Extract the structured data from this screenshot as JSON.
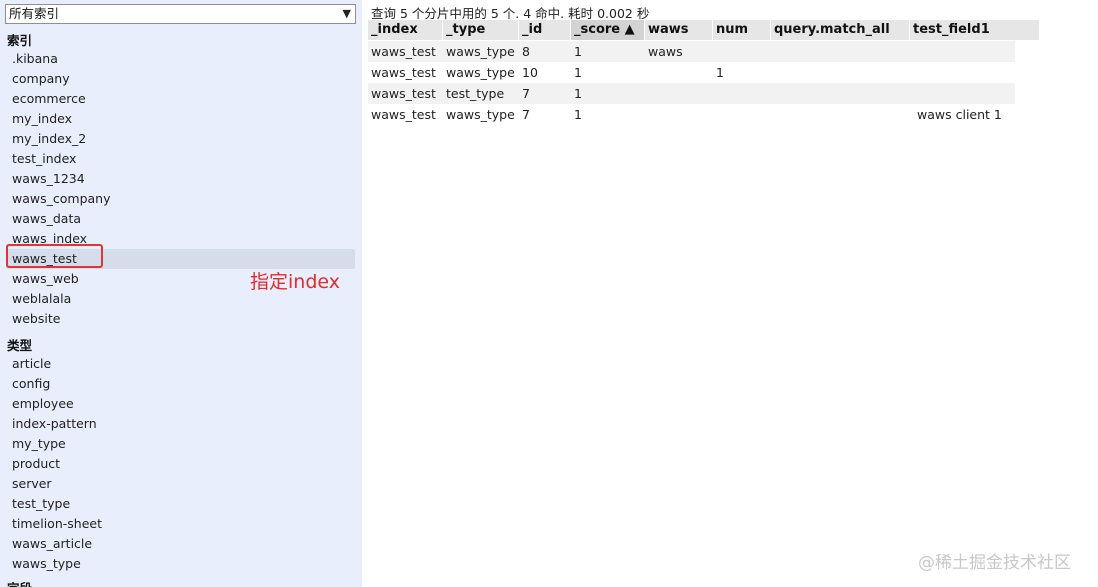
{
  "sidebar": {
    "index_select_value": "所有索引",
    "indices_title": "索引",
    "indices": [
      ".kibana",
      "company",
      "ecommerce",
      "my_index",
      "my_index_2",
      "test_index",
      "waws_1234",
      "waws_company",
      "waws_data",
      "waws_index",
      "waws_test",
      "waws_web",
      "weblalala",
      "website"
    ],
    "types_title": "类型",
    "types": [
      "article",
      "config",
      "employee",
      "index-pattern",
      "my_type",
      "product",
      "server",
      "test_type",
      "timelion-sheet",
      "waws_article",
      "waws_type"
    ],
    "fields_title": "字段"
  },
  "annotation": {
    "text": "指定index"
  },
  "results": {
    "summary": "查询 5 个分片中用的 5 个. 4 命中. 耗时 0.002 秒",
    "columns": [
      "_index",
      "_type",
      "_id",
      "_score ▲",
      "waws",
      "num",
      "query.match_all",
      "test_field1"
    ],
    "rows": [
      [
        "waws_test",
        "waws_type",
        "8",
        "1",
        "waws",
        "",
        "",
        ""
      ],
      [
        "waws_test",
        "waws_type",
        "10",
        "1",
        "",
        "1",
        "",
        ""
      ],
      [
        "waws_test",
        "test_type",
        "7",
        "1",
        "",
        "",
        "",
        ""
      ],
      [
        "waws_test",
        "waws_type",
        "7",
        "1",
        "",
        "",
        "",
        "waws client 1"
      ]
    ]
  },
  "watermark": "@稀土掘金技术社区"
}
